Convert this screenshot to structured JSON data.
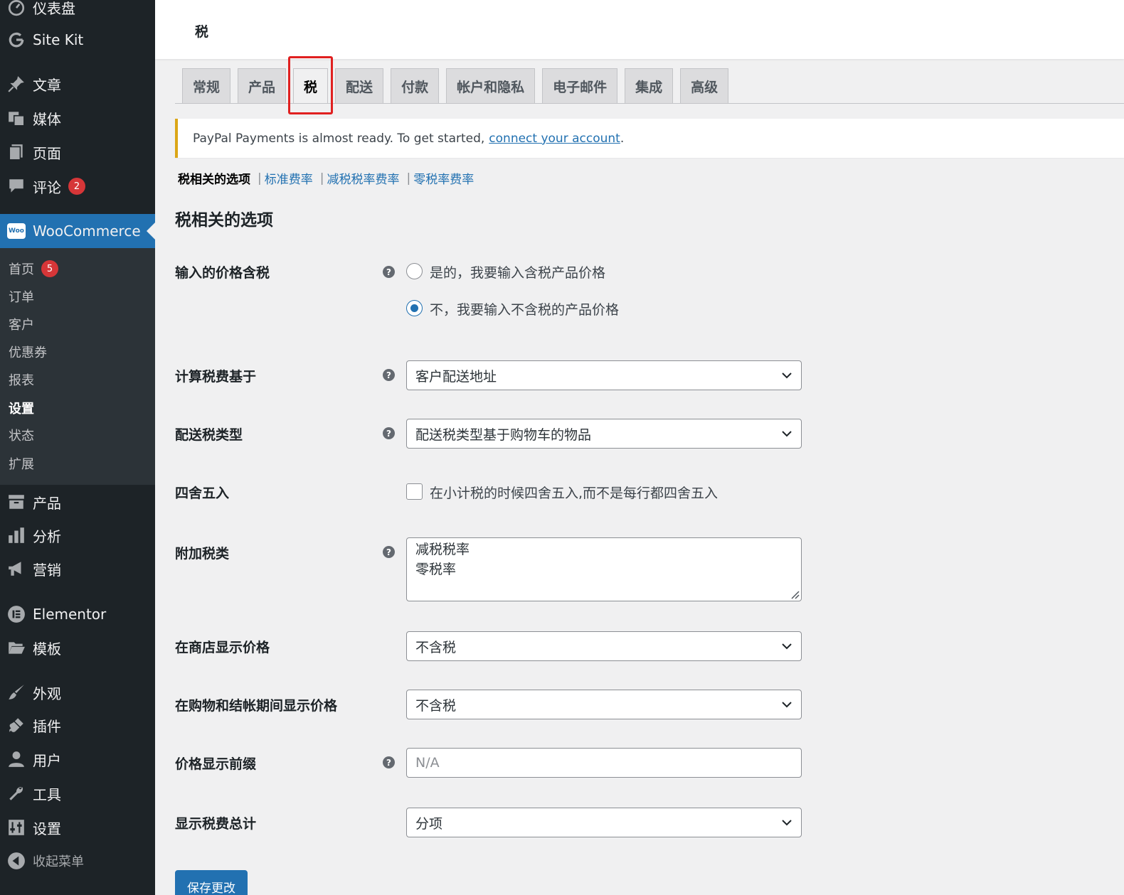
{
  "sidebar": {
    "items": [
      {
        "label": "仪表盘",
        "icon": "dashboard-icon"
      },
      {
        "label": "Site Kit",
        "icon": "google-g-icon"
      },
      {
        "label": "文章",
        "icon": "pin-icon"
      },
      {
        "label": "媒体",
        "icon": "media-icon"
      },
      {
        "label": "页面",
        "icon": "page-icon"
      },
      {
        "label": "评论",
        "icon": "comment-icon",
        "badge": "2"
      },
      {
        "label": "WooCommerce",
        "icon": "woo-icon"
      },
      {
        "label": "产品",
        "icon": "archive-icon"
      },
      {
        "label": "分析",
        "icon": "bar-chart-icon"
      },
      {
        "label": "营销",
        "icon": "megaphone-icon"
      },
      {
        "label": "Elementor",
        "icon": "elementor-icon"
      },
      {
        "label": "模板",
        "icon": "folder-icon"
      },
      {
        "label": "外观",
        "icon": "paintbrush-icon"
      },
      {
        "label": "插件",
        "icon": "plugin-icon"
      },
      {
        "label": "用户",
        "icon": "user-icon"
      },
      {
        "label": "工具",
        "icon": "wrench-icon"
      },
      {
        "label": "设置",
        "icon": "settings-icon"
      },
      {
        "label": "收起菜单",
        "icon": "collapse-icon"
      }
    ],
    "woo_logo_text": "Woo",
    "submenu": [
      {
        "label": "首页",
        "badge": "5"
      },
      {
        "label": "订单"
      },
      {
        "label": "客户"
      },
      {
        "label": "优惠券"
      },
      {
        "label": "报表"
      },
      {
        "label": "设置",
        "active": true
      },
      {
        "label": "状态"
      },
      {
        "label": "扩展"
      }
    ]
  },
  "header": {
    "title": "税"
  },
  "tabs": [
    "常规",
    "产品",
    "税",
    "配送",
    "付款",
    "帐户和隐私",
    "电子邮件",
    "集成",
    "高级"
  ],
  "active_tab": "税",
  "notice": {
    "text": "PayPal Payments is almost ready. To get started,",
    "link": "connect your account",
    "suffix": "."
  },
  "subnav": {
    "current": "税相关的选项",
    "links": [
      "标准费率",
      "减税税率费率",
      "零税率费率"
    ],
    "separator": "|"
  },
  "section_title": "税相关的选项",
  "help_glyph": "?",
  "fields": {
    "prices_entered": {
      "label": "输入的价格含税",
      "options": [
        "是的，我要输入含税产品价格",
        "不，我要输入不含税的产品价格"
      ],
      "selected_index": 1
    },
    "calc_based_on": {
      "label": "计算税费基于",
      "value": "客户配送地址"
    },
    "shipping_tax_class": {
      "label": "配送税类型",
      "value": "配送税类型基于购物车的物品"
    },
    "rounding": {
      "label": "四舍五入",
      "checkbox_label": "在小计税的时候四舍五入,而不是每行都四舍五入",
      "checked": false
    },
    "additional_classes": {
      "label": "附加税类",
      "lines": [
        "减税税率",
        "零税率"
      ]
    },
    "display_shop": {
      "label": "在商店显示价格",
      "value": "不含税"
    },
    "display_cart": {
      "label": "在购物和结帐期间显示价格",
      "value": "不含税"
    },
    "price_suffix": {
      "label": "价格显示前缀",
      "placeholder": "N/A",
      "value": ""
    },
    "display_totals": {
      "label": "显示税费总计",
      "value": "分项"
    }
  },
  "save_label": "保存更改",
  "colors": {
    "accent": "#2271b1",
    "sidebar": "#1d2327",
    "badge": "#d63638",
    "highlight": "#e02020",
    "notice_border": "#dba617"
  }
}
